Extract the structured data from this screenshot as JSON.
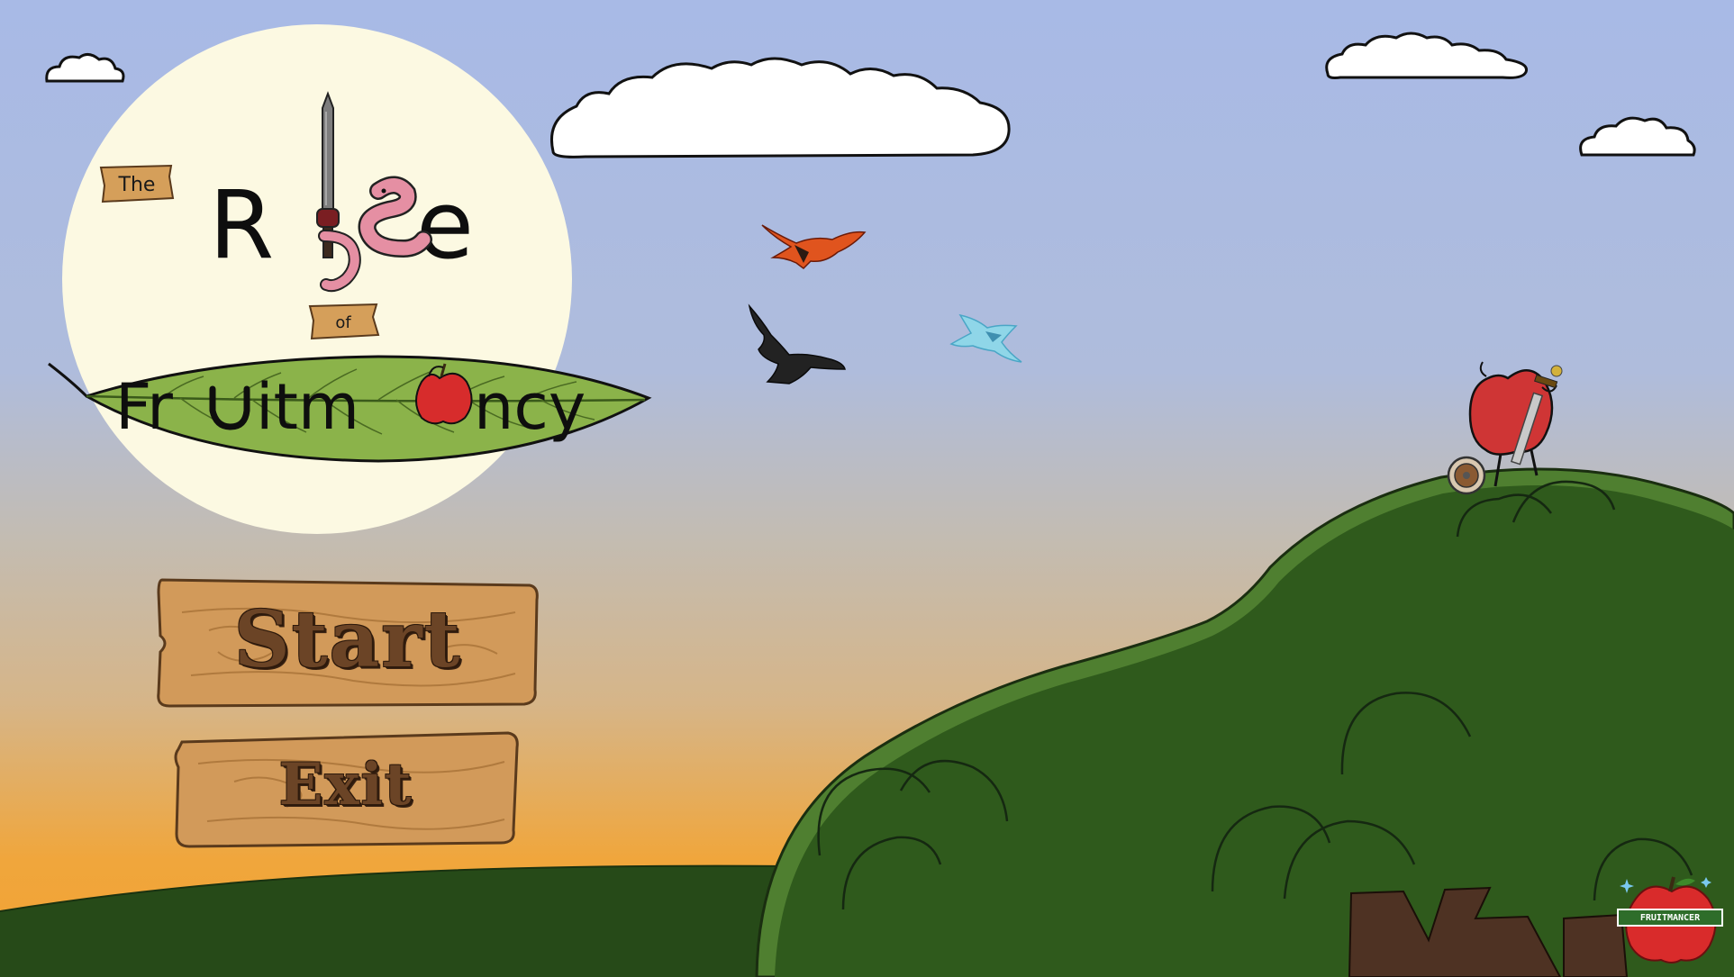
{
  "title": {
    "the": "The",
    "rise": "Rise",
    "of": "of",
    "fruitmancy": "Fruitmancy"
  },
  "menu": {
    "start_label": "Start",
    "exit_label": "Exit"
  },
  "badge": {
    "text": "FRUITMANCER"
  },
  "colors": {
    "sky_top": "#a8bae6",
    "sky_mid": "#c4bdb0",
    "sky_bottom": "#f2a536",
    "moon": "#fcf9e2",
    "hill": "#2f5a1c",
    "hill_rim": "#4a7c2e",
    "ground": "#1f3d14",
    "trunk": "#4e3223",
    "wood": "#d29a5a",
    "leaf": "#8bb34a",
    "apple": "#d02a2a"
  }
}
